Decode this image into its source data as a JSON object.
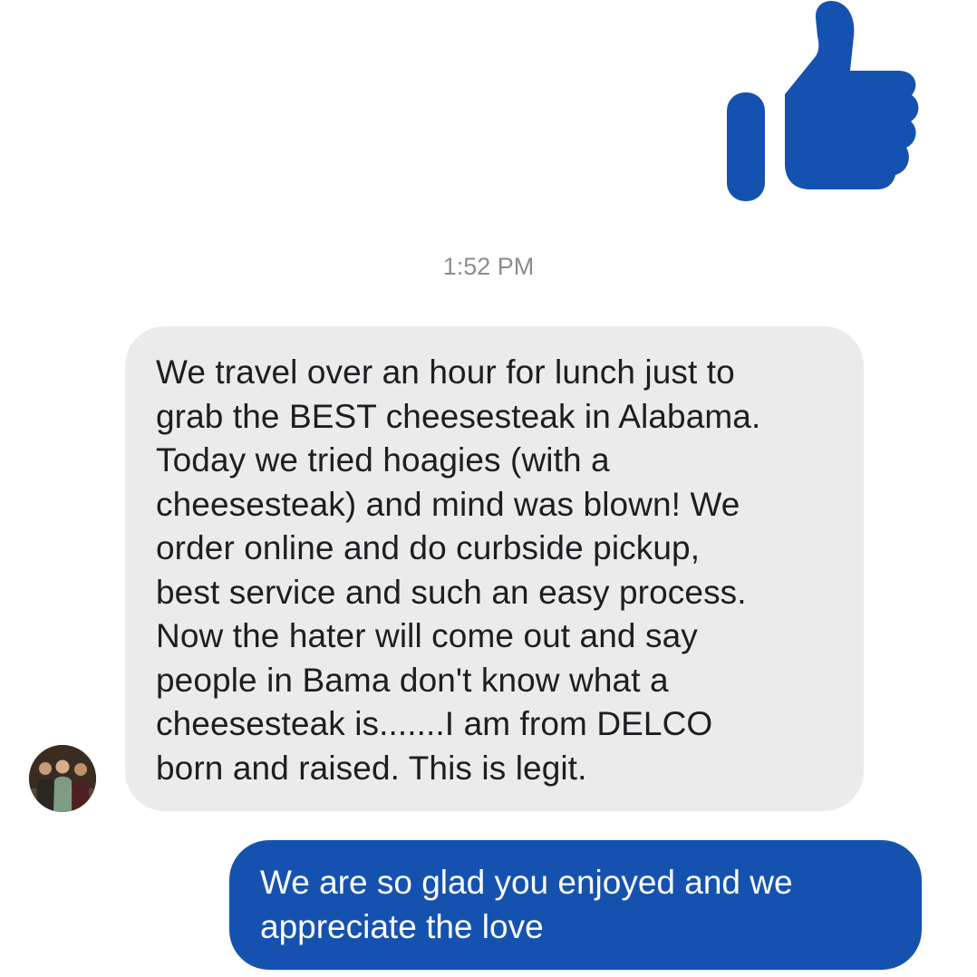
{
  "conversation": {
    "like_sticker_icon": "thumbs-up-icon",
    "timestamp": "1:52 PM",
    "incoming_message": {
      "avatar_icon": "avatar-group-photo",
      "text": "We travel over an hour for lunch just to\ngrab the BEST cheesesteak in Alabama.\nToday we tried hoagies (with a\ncheesesteak) and mind was blown!  We\norder online and do curbside pickup,\nbest service and such an easy process.\nNow the hater will come out and say\npeople in Bama don't know what a\ncheesesteak is.......I am from DELCO\nborn and raised.  This is legit."
    },
    "outgoing_message": {
      "text": "We are so glad you enjoyed and we\nappreciate the love"
    }
  },
  "colors": {
    "accent": "#1552b0",
    "incoming_bubble": "#ebebeb",
    "timestamp_text": "#8a8d91"
  }
}
